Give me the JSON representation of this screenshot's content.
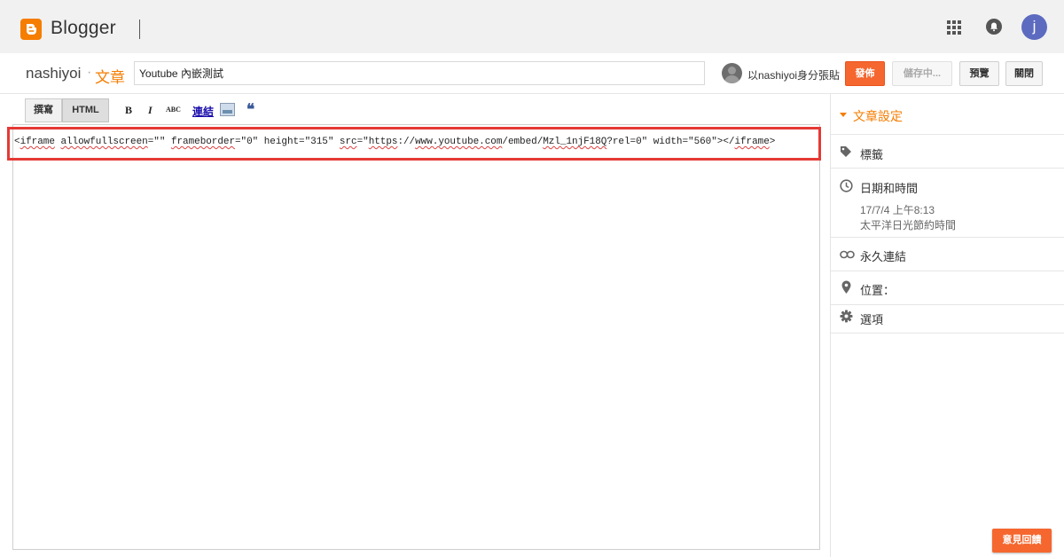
{
  "header": {
    "brand": "Blogger",
    "user_initial": "j"
  },
  "post": {
    "blog_name": "nashiyoi",
    "separator": "·",
    "section": "文章",
    "title_value": "Youtube 內嵌測試",
    "author_label": "以nashiyoi身分張貼"
  },
  "actions": {
    "publish": "發佈",
    "saving": "儲存中...",
    "preview": "預覽",
    "close": "關閉"
  },
  "toolbar": {
    "compose": "撰寫",
    "html": "HTML",
    "bold": "B",
    "italic": "I",
    "spell": "ABC",
    "link": "連結",
    "quote": "❝"
  },
  "code": {
    "p1": "<",
    "tag_open": "iframe",
    "p2": " ",
    "attr1": "allowfullscreen",
    "p3": "=\"\" ",
    "attr2": "frameborder",
    "p4": "=\"0\" height=\"315\" ",
    "attr3": "src",
    "p5": "=\"",
    "url1": "https",
    "p6": "://",
    "url2": "www.youtube.com",
    "p7": "/embed/",
    "url3": "Mzl_1njF18Q",
    "p8": "?rel=0\" width=\"560\"></",
    "tag_close": "iframe",
    "p9": ">"
  },
  "sidebar": {
    "title": "文章設定",
    "labels": "標籤",
    "datetime": "日期和時間",
    "date_value": "17/7/4 上午8:13",
    "timezone": "太平洋日光節約時間",
    "permalink": "永久連結",
    "location": "位置：",
    "options": "選項"
  },
  "feedback": "意見回饋",
  "colors": {
    "accent": "#f57d00",
    "publish": "#f5672f",
    "highlight": "#e53935"
  },
  "icons": [
    "blogger-logo-icon",
    "apps-grid-icon",
    "notification-bell-icon",
    "caret-down-icon",
    "tag-icon",
    "clock-icon",
    "link-icon",
    "location-pin-icon",
    "gear-icon",
    "insert-image-icon"
  ]
}
